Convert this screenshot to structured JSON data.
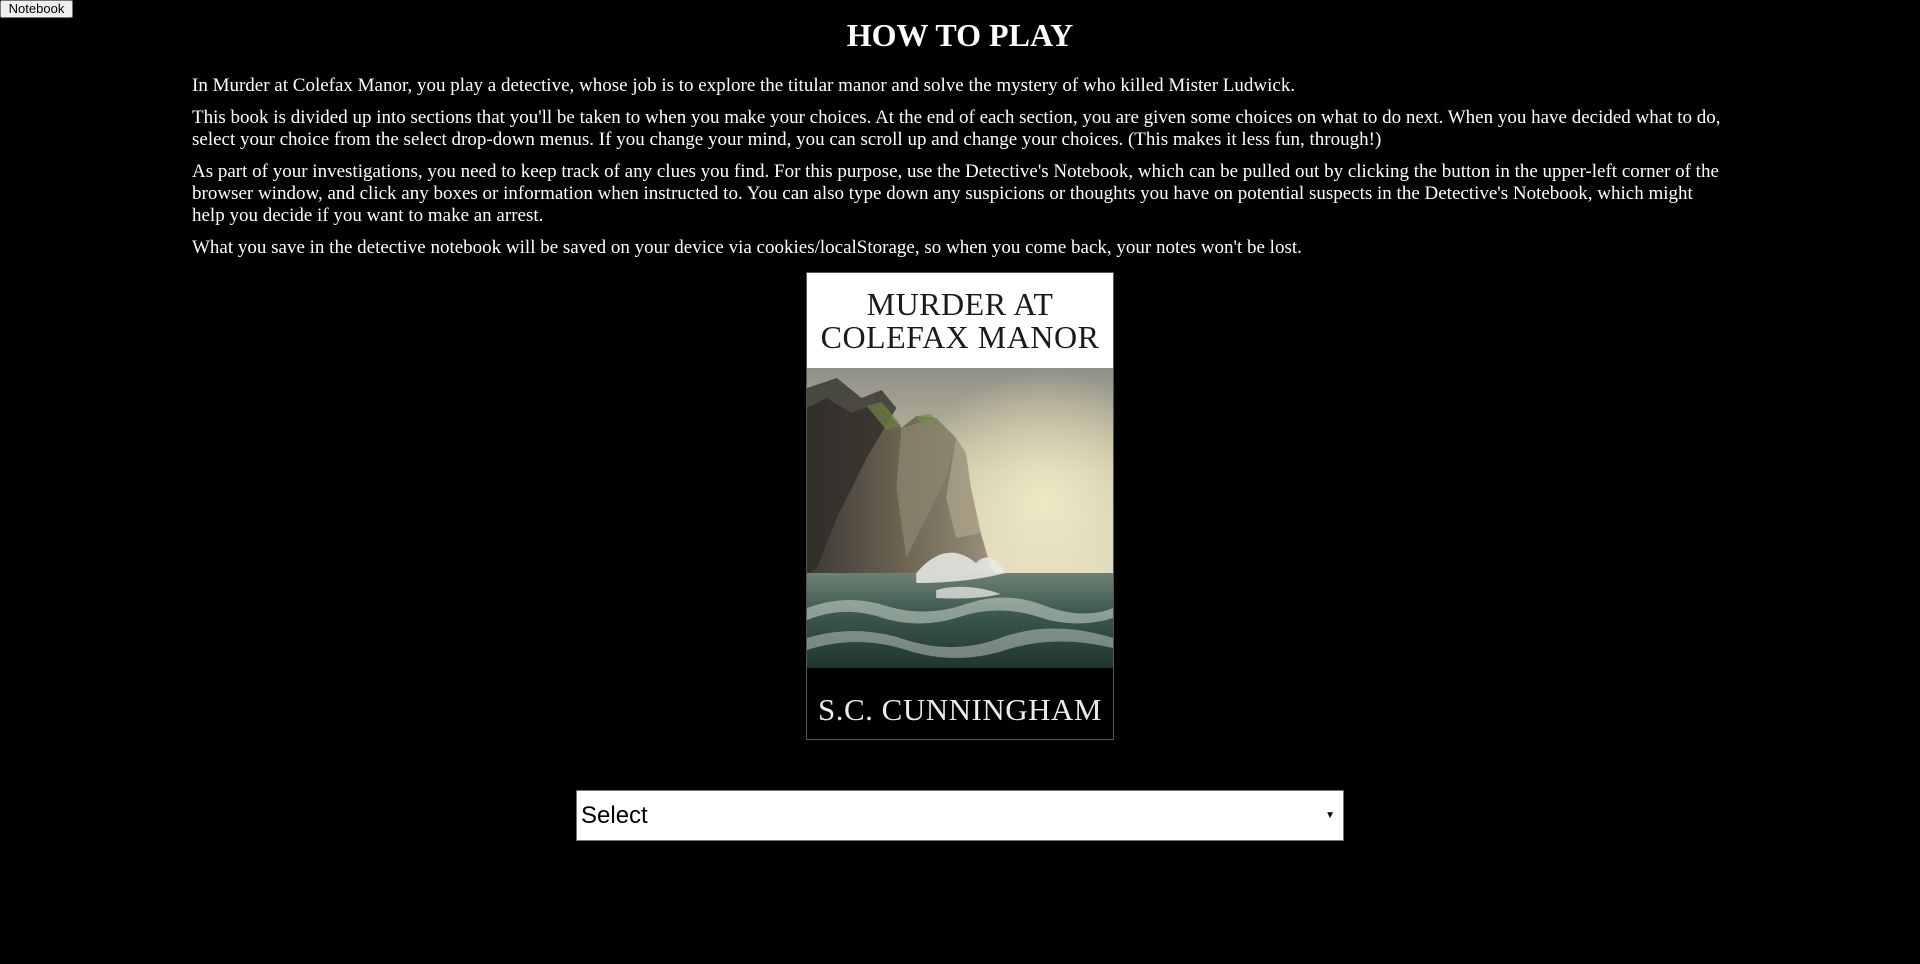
{
  "toolbar": {
    "notebook_label": "Notebook"
  },
  "page": {
    "title": "HOW TO PLAY",
    "paragraphs": [
      "In Murder at Colefax Manor, you play a detective, whose job is to explore the titular manor and solve the mystery of who killed Mister Ludwick.",
      "This book is divided up into sections that you'll be taken to when you make your choices. At the end of each section, you are given some choices on what to do next. When you have decided what to do, select your choice from the select drop-down menus. If you change your mind, you can scroll up and change your choices. (This makes it less fun, through!)",
      "As part of your investigations, you need to keep track of any clues you find. For this purpose, use the Detective's Notebook, which can be pulled out by clicking the button in the upper-left corner of the browser window, and click any boxes or information when instructed to. You can also type down any suspicions or thoughts you have on potential suspects in the Detective's Notebook, which might help you decide if you want to make an arrest.",
      "What you save in the detective notebook will be saved on your device via cookies/localStorage, so when you come back, your notes won't be lost."
    ]
  },
  "cover": {
    "title_line1": "MURDER AT",
    "title_line2": "COLEFAX MANOR",
    "author": "S.C. CUNNINGHAM"
  },
  "choice": {
    "selected": "Select",
    "arrow_icon": "triangle-down-icon"
  },
  "colors": {
    "background": "#000000",
    "text": "#ffffff"
  }
}
